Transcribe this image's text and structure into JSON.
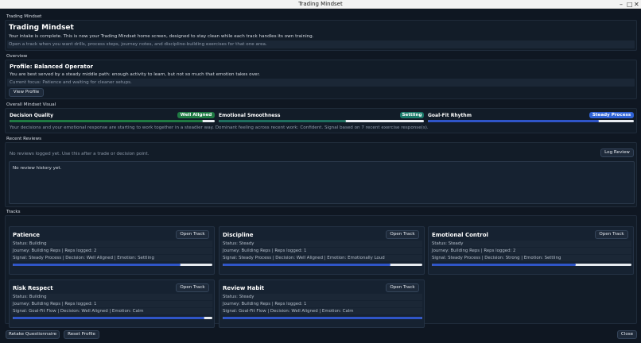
{
  "window": {
    "title": "Trading Mindset",
    "controls": {
      "minimize": "–",
      "maximize": "□",
      "close": "✕"
    }
  },
  "home": {
    "group_label": "Trading Mindset",
    "title": "Trading Mindset",
    "line1": "Your intake is complete. This is now your Trading Mindset home screen, designed to stay clean while each track handles its own training.",
    "line2": "Open a track when you want drills, process steps, journey notes, and discipline-building exercises for that one area."
  },
  "overview": {
    "group_label": "Overview",
    "profile_title": "Profile: Balanced Operator",
    "line1": "You are best served by a steady middle path: enough activity to learn, but not so much that emotion takes over.",
    "line2": "Current focus: Patience and waiting for cleaner setups.",
    "view_profile_label": "View Profile"
  },
  "visual": {
    "group_label": "Overall Mindset Visual",
    "metrics": [
      {
        "label": "Decision Quality",
        "badge": "Well Aligned",
        "badge_color": "#1f7a43",
        "fill_color": "#1f7a43",
        "fill": 0.94
      },
      {
        "label": "Emotional Smoothness",
        "badge": "Settling",
        "badge_color": "#1a7a6a",
        "fill_color": "#1f6e5f",
        "fill": 0.62
      },
      {
        "label": "Goal-Fit Rhythm",
        "badge": "Steady Process",
        "badge_color": "#2f63d6",
        "fill_color": "#2f55c8",
        "fill": 0.83
      }
    ],
    "summary": "Your decisions and your emotional response are starting to work together in a steadier way. Dominant feeling across recent work: Confident. Signal based on 7 recent exercise response(s)."
  },
  "reviews": {
    "group_label": "Recent Reviews",
    "note": "No reviews logged yet. Use this after a trade or decision point.",
    "log_review_label": "Log Review",
    "history_text": "No review history yet."
  },
  "tracks": {
    "group_label": "Tracks",
    "open_label": "Open Track",
    "items": [
      {
        "name": "Patience",
        "status": "Status: Building",
        "journey": "Journey: Building Reps  |  Reps logged: 2",
        "signal": "Signal: Steady Process  |  Decision: Well Aligned  |  Emotion: Settling",
        "fill": 0.84,
        "fill_color": "#2f55c8"
      },
      {
        "name": "Discipline",
        "status": "Status: Steady",
        "journey": "Journey: Building Reps  |  Reps logged: 1",
        "signal": "Signal: Steady Process  |  Decision: Well Aligned  |  Emotion: Emotionally Loud",
        "fill": 0.84,
        "fill_color": "#2f55c8"
      },
      {
        "name": "Emotional Control",
        "status": "Status: Steady",
        "journey": "Journey: Building Reps  |  Reps logged: 2",
        "signal": "Signal: Steady Process  |  Decision: Strong  |  Emotion: Settling",
        "fill": 0.72,
        "fill_color": "#2f55c8"
      },
      {
        "name": "Risk Respect",
        "status": "Status: Building",
        "journey": "Journey: Building Reps  |  Reps logged: 1",
        "signal": "Signal: Goal-Fit Flow  |  Decision: Well Aligned  |  Emotion: Calm",
        "fill": 0.96,
        "fill_color": "#2f55c8"
      },
      {
        "name": "Review Habit",
        "status": "Status: Steady",
        "journey": "Journey: Building Reps  |  Reps logged: 1",
        "signal": "Signal: Goal-Fit Flow  |  Decision: Well Aligned  |  Emotion: Calm",
        "fill": 1.0,
        "fill_color": "#2f55c8"
      }
    ]
  },
  "footer": {
    "retake_label": "Retake Questionnaire",
    "reset_label": "Reset Profile",
    "close_label": "Close"
  }
}
